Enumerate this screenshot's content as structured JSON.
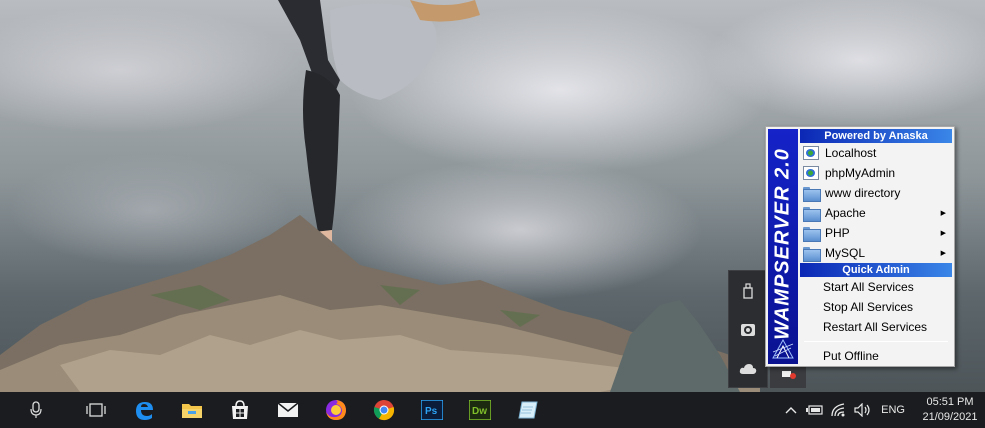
{
  "wamp_menu": {
    "side_title": "WAMPSERVER 2.0",
    "header_powered": "Powered by Anaska",
    "items": [
      {
        "label": "Localhost",
        "icon": "web-page-icon",
        "submenu": false
      },
      {
        "label": "phpMyAdmin",
        "icon": "web-page-icon",
        "submenu": false
      },
      {
        "label": "www directory",
        "icon": "folder-icon",
        "submenu": false
      },
      {
        "label": "Apache",
        "icon": "folder-icon",
        "submenu": true
      },
      {
        "label": "PHP",
        "icon": "folder-icon",
        "submenu": true
      },
      {
        "label": "MySQL",
        "icon": "folder-icon",
        "submenu": true
      }
    ],
    "header_quick_admin": "Quick Admin",
    "quick_admin": {
      "start": "Start All Services",
      "stop": "Stop All Services",
      "restart": "Restart All Services",
      "offline": "Put Offline"
    },
    "colors": {
      "side": "#1523c8",
      "header": "#0b27b5"
    }
  },
  "taskbar": {
    "apps": [
      "microphone-icon",
      "task-view-icon",
      "edge-icon",
      "file-explorer-icon",
      "store-icon",
      "mail-icon",
      "firefox-icon",
      "chrome-icon",
      "photoshop-icon",
      "dreamweaver-icon",
      "notepad-icon"
    ],
    "photoshop_label": "Ps",
    "dreamweaver_label": "Dw",
    "tray": {
      "language": "ENG",
      "time": "05:51 PM",
      "date": "21/09/2021"
    }
  }
}
